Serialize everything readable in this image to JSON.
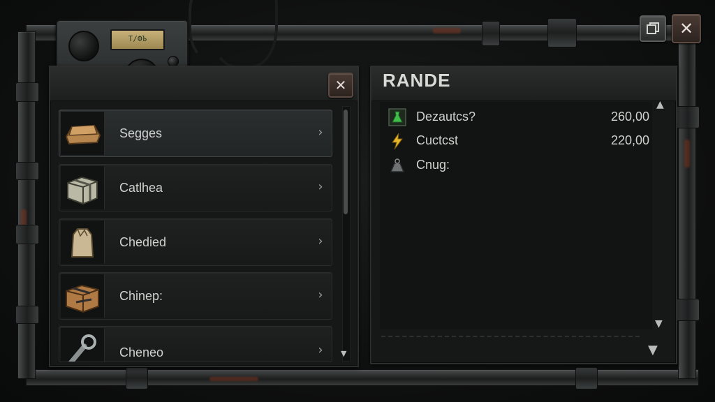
{
  "window": {
    "close_label": "✕",
    "restore_icon": "window-restore-icon"
  },
  "left_panel": {
    "close_label": "✕",
    "items": [
      {
        "label": "Segges",
        "icon": "bread-loaf-icon",
        "selected": true
      },
      {
        "label": "Catlhea",
        "icon": "crate-icon",
        "selected": false
      },
      {
        "label": "Chedied",
        "icon": "paper-bag-icon",
        "selected": false
      },
      {
        "label": "Chinep:",
        "icon": "wrapped-package-icon",
        "selected": false
      },
      {
        "label": "Cheneo",
        "icon": "wrench-tool-icon",
        "selected": false
      }
    ],
    "chevron": "›"
  },
  "radio": {
    "screen_text": "Т/ФЪ"
  },
  "right_panel": {
    "title": "RANDE",
    "stats": [
      {
        "label": "Dezautcs?",
        "value": "260,00",
        "icon": "green-flask-icon"
      },
      {
        "label": "Cuctcst",
        "value": "220,00",
        "icon": "lightning-bolt-icon"
      },
      {
        "label": "Cnug:",
        "value": "",
        "icon": "weight-icon"
      }
    ],
    "arrows": {
      "up": "▲",
      "down": "▼"
    }
  },
  "colors": {
    "accent_green": "#3fbf4a",
    "bolt_yellow": "#e8b628",
    "rust": "#7a3620"
  }
}
